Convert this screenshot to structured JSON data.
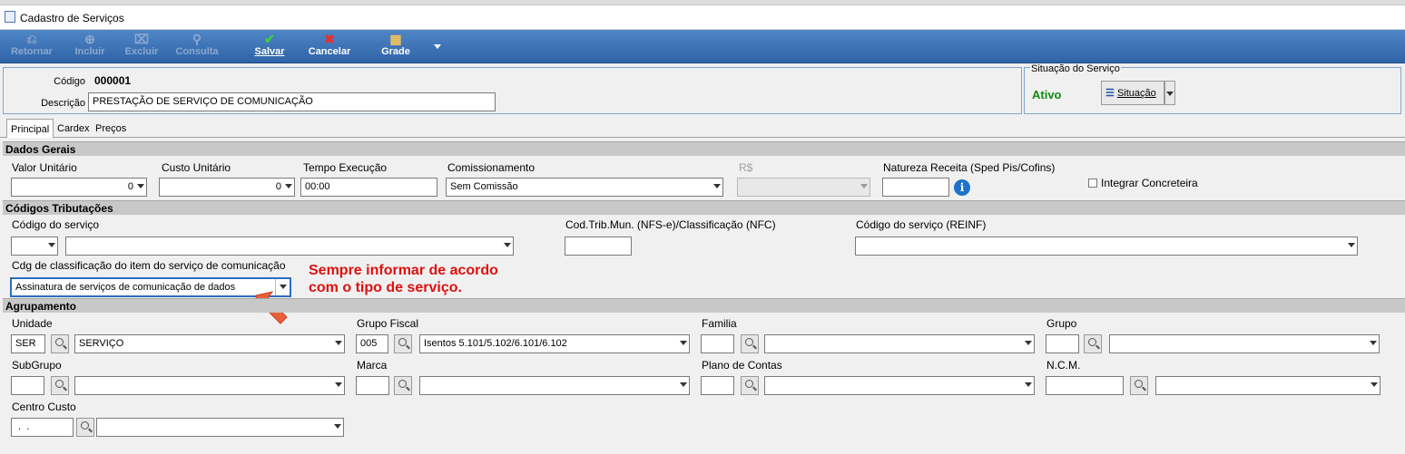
{
  "window": {
    "title": "Cadastro de Serviços"
  },
  "toolbar": {
    "buttons": [
      {
        "label": "Retornar",
        "icon": "return-icon",
        "enabled": false
      },
      {
        "label": "Incluir",
        "icon": "add-icon",
        "enabled": false
      },
      {
        "label": "Excluir",
        "icon": "trash-icon",
        "enabled": false
      },
      {
        "label": "Consulta",
        "icon": "search-icon",
        "enabled": false
      },
      {
        "label": "Salvar",
        "icon": "check-icon",
        "enabled": true
      },
      {
        "label": "Cancelar",
        "icon": "cancel-icon",
        "enabled": true
      },
      {
        "label": "Grade",
        "icon": "grid-icon",
        "enabled": true
      }
    ]
  },
  "header": {
    "codigo_label": "Código",
    "codigo_value": "000001",
    "descricao_label": "Descrição",
    "descricao_value": "PRESTAÇÃO DE SERVIÇO DE COMUNICAÇÃO"
  },
  "situacao": {
    "title": "Situação do Serviço",
    "status": "Ativo",
    "status_color": "#138a13",
    "button_label": "Situação"
  },
  "tabs": [
    "Principal",
    "Cardex",
    "Preços"
  ],
  "dados_gerais": {
    "title": "Dados Gerais",
    "valor_unitario_label": "Valor Unitário",
    "valor_unitario_value": "0",
    "custo_unitario_label": "Custo Unitário",
    "custo_unitario_value": "0",
    "tempo_execucao_label": "Tempo Execução",
    "tempo_execucao_value": "00:00",
    "comissionamento_label": "Comissionamento",
    "comissionamento_value": "Sem Comissão",
    "rs_label": "R$",
    "natureza_label": "Natureza Receita (Sped Pis/Cofins)",
    "natureza_value": "",
    "integrar_label": "Integrar Concreteira"
  },
  "codigos": {
    "title": "Códigos Tributações",
    "codigo_servico_label": "Código do serviço",
    "cod_trib_label": "Cod.Trib.Mun. (NFS-e)/Classificação (NFC)",
    "codigo_reinf_label": "Código do serviço (REINF)",
    "cdg_class_label": "Cdg de classificação do item do serviço de comunicação",
    "cdg_class_value": "Assinatura de serviços de comunicação de dados"
  },
  "annotation": {
    "line1": "Sempre informar de acordo",
    "line2": "com o tipo de serviço.",
    "color": "#e01010"
  },
  "agrupamento": {
    "title": "Agrupamento",
    "unidade_label": "Unidade",
    "unidade_code": "SER",
    "unidade_desc": "SERVIÇO",
    "grupo_fiscal_label": "Grupo Fiscal",
    "grupo_fiscal_code": "005",
    "grupo_fiscal_desc": "Isentos 5.101/5.102/6.101/6.102",
    "familia_label": "Familia",
    "grupo_label": "Grupo",
    "subgrupo_label": "SubGrupo",
    "marca_label": "Marca",
    "plano_label": "Plano de Contas",
    "ncm_label": "N.C.M.",
    "centro_custo_label": "Centro Custo",
    "centro_custo_code": " .  ."
  }
}
